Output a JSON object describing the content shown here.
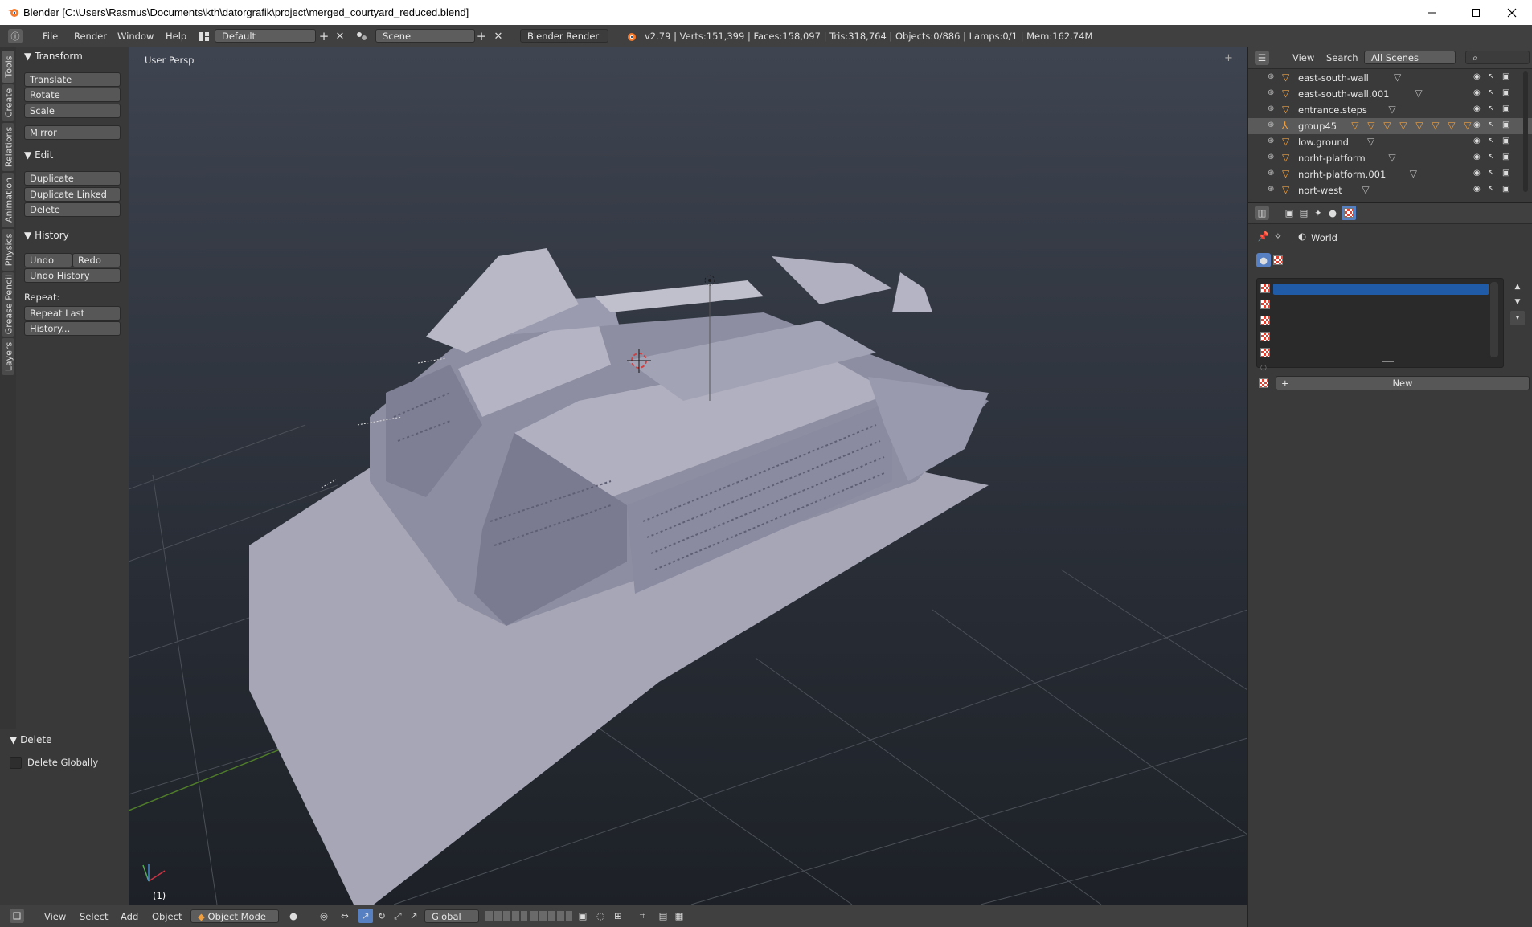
{
  "window": {
    "title": "Blender [C:\\Users\\Rasmus\\Documents\\kth\\datorgrafik\\project\\merged_courtyard_reduced.blend]",
    "minimize_icon": "minimize-icon",
    "maximize_icon": "maximize-icon",
    "close_icon": "close-icon"
  },
  "topbar": {
    "menus": [
      "File",
      "Render",
      "Window",
      "Help"
    ],
    "screen_layout": "Default",
    "scene": "Scene",
    "render_engine": "Blender Render",
    "stats": "v2.79 | Verts:151,399 | Faces:158,097 | Tris:318,764 | Objects:0/886 | Lamps:0/1 | Mem:162.74M"
  },
  "tool_tabs": [
    "Tools",
    "Create",
    "Relations",
    "Animation",
    "Physics",
    "Grease Pencil",
    "Layers"
  ],
  "tool_shelf": {
    "transform_header": "Transform",
    "translate": "Translate",
    "rotate": "Rotate",
    "scale": "Scale",
    "mirror": "Mirror",
    "edit_header": "Edit",
    "duplicate": "Duplicate",
    "duplicate_linked": "Duplicate Linked",
    "delete": "Delete",
    "history_header": "History",
    "undo": "Undo",
    "redo": "Redo",
    "undo_history": "Undo History",
    "repeat_label": "Repeat:",
    "repeat_last": "Repeat Last",
    "history": "History..."
  },
  "operator_panel": {
    "header": "Delete",
    "delete_globally": "Delete Globally",
    "delete_globally_checked": false
  },
  "viewport": {
    "label": "User Persp",
    "frame": "(1)"
  },
  "bottombar": {
    "menus": [
      "View",
      "Select",
      "Add",
      "Object"
    ],
    "mode": "Object Mode",
    "orientation": "Global"
  },
  "outliner": {
    "menus": [
      "View",
      "Search"
    ],
    "scope": "All Scenes",
    "items": [
      {
        "name": "east-south-wall",
        "selected": false,
        "group": false,
        "mesh_icons": 1
      },
      {
        "name": "east-south-wall.001",
        "selected": false,
        "group": false,
        "mesh_icons": 1
      },
      {
        "name": "entrance.steps",
        "selected": false,
        "group": false,
        "mesh_icons": 1
      },
      {
        "name": "group45",
        "selected": true,
        "group": true,
        "mesh_icons": 8
      },
      {
        "name": "low.ground",
        "selected": false,
        "group": false,
        "mesh_icons": 1
      },
      {
        "name": "norht-platform",
        "selected": false,
        "group": false,
        "mesh_icons": 1
      },
      {
        "name": "norht-platform.001",
        "selected": false,
        "group": false,
        "mesh_icons": 1
      },
      {
        "name": "nort-west",
        "selected": false,
        "group": false,
        "mesh_icons": 1
      }
    ]
  },
  "properties": {
    "context": "World",
    "new_button": "New",
    "texture_slots": 6
  },
  "colors": {
    "accent_orange": "#f0a040",
    "selection_blue": "#1f5ba6",
    "header_bg": "#404040",
    "panel_bg": "#393939",
    "button_bg": "#575757"
  }
}
